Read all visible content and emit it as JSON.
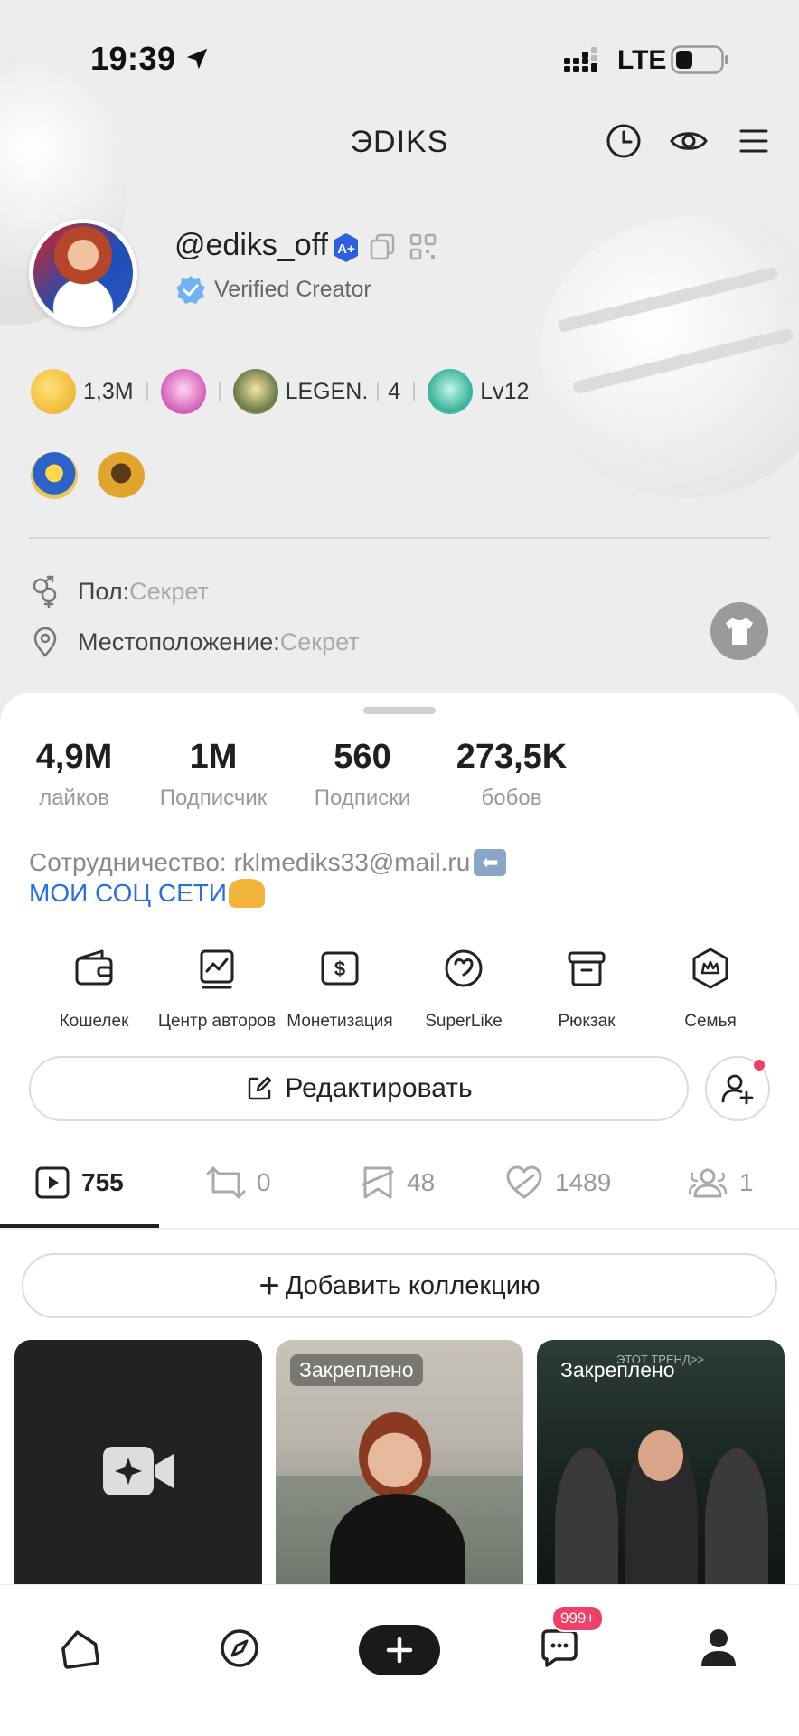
{
  "status": {
    "time": "19:39",
    "network": "LTE"
  },
  "header": {
    "title": "ЭDIKS"
  },
  "profile": {
    "username": "@ediks_off",
    "badge_label": "A+",
    "verified_label": "Verified Creator"
  },
  "badges": {
    "likes_value": "1,3M",
    "rank_label": "LEGEN.",
    "rank_number": "4",
    "level_label": "Lv12"
  },
  "info": {
    "gender_label": "Пол:",
    "gender_value": "Секрет",
    "location_label": "Местоположение:",
    "location_value": "Секрет"
  },
  "stats": [
    {
      "value": "4,9M",
      "label": "лайков"
    },
    {
      "value": "1M",
      "label": "Подписчик"
    },
    {
      "value": "560",
      "label": "Подписки"
    },
    {
      "value": "273,5K",
      "label": "бобов"
    }
  ],
  "bio": {
    "line1": "Сотрудничество: rklmediks33@mail.ru",
    "line2": "МОИ СОЦ СЕТИ"
  },
  "tools": [
    {
      "label": "Кошелек",
      "icon": "wallet-icon"
    },
    {
      "label": "Центр авторов",
      "icon": "chart-icon"
    },
    {
      "label": "Монетизация",
      "icon": "dollar-icon"
    },
    {
      "label": "SuperLike",
      "icon": "superlike-icon"
    },
    {
      "label": "Рюкзак",
      "icon": "backpack-icon"
    },
    {
      "label": "Семья",
      "icon": "family-icon"
    }
  ],
  "actions": {
    "edit_label": "Редактировать"
  },
  "tabs": [
    {
      "count": "755",
      "icon": "video-icon"
    },
    {
      "count": "0",
      "icon": "repost-icon"
    },
    {
      "count": "48",
      "icon": "bookmark-icon"
    },
    {
      "count": "1489",
      "icon": "heart-icon"
    },
    {
      "count": "1",
      "icon": "group-icon"
    }
  ],
  "collection": {
    "add_label": "Добавить коллекцию"
  },
  "videos": [
    {
      "pinned_label": "Закреплено"
    },
    {
      "pinned_label": "Закреплено",
      "overlay_text": "ЭТОТ ТРЕНД>>"
    }
  ],
  "nav": {
    "inbox_badge": "999+"
  },
  "colors": {
    "accent_blue": "#2a6fe0",
    "badge_pink": "#f0406a",
    "dark": "#1a1a1a"
  }
}
